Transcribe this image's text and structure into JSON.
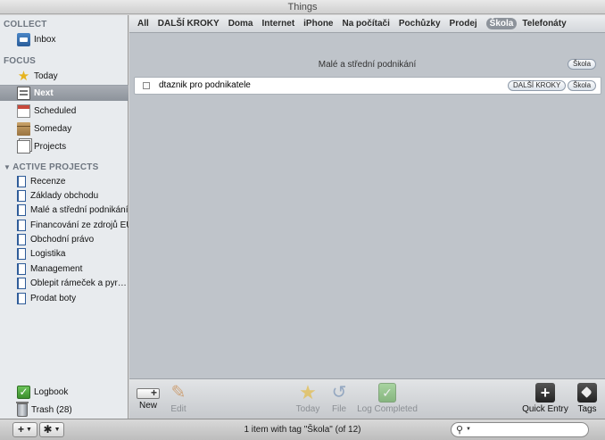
{
  "window": {
    "title": "Things"
  },
  "sidebar": {
    "collect": {
      "label": "COLLECT",
      "items": [
        {
          "label": "Inbox",
          "icon": "inbox-icon"
        }
      ]
    },
    "focus": {
      "label": "FOCUS",
      "items": [
        {
          "label": "Today",
          "icon": "star-icon"
        },
        {
          "label": "Next",
          "icon": "next-list-icon",
          "selected": true
        },
        {
          "label": "Scheduled",
          "icon": "calendar-icon"
        },
        {
          "label": "Someday",
          "icon": "box-icon"
        },
        {
          "label": "Projects",
          "icon": "projects-icon"
        }
      ]
    },
    "active_projects": {
      "label": "ACTIVE PROJECTS",
      "items": [
        {
          "label": "Recenze"
        },
        {
          "label": "Základy obchodu"
        },
        {
          "label": "Malé a střední podnikání"
        },
        {
          "label": "Financování ze zdrojů EU"
        },
        {
          "label": "Obchodní právo"
        },
        {
          "label": "Logistika"
        },
        {
          "label": "Management"
        },
        {
          "label": "Oblepit rámeček a pyr…"
        },
        {
          "label": "Prodat boty"
        }
      ]
    },
    "bottom": [
      {
        "label": "Logbook",
        "icon": "logbook-icon"
      },
      {
        "label": "Trash (28)",
        "icon": "trash-icon"
      }
    ]
  },
  "tags": [
    {
      "label": "All"
    },
    {
      "label": "DALŠÍ KROKY"
    },
    {
      "label": "Doma"
    },
    {
      "label": "Internet"
    },
    {
      "label": "iPhone"
    },
    {
      "label": "Na počítači"
    },
    {
      "label": "Pochůzky"
    },
    {
      "label": "Prodej"
    },
    {
      "label": "Škola",
      "active": true
    },
    {
      "label": "Telefonáty"
    }
  ],
  "main": {
    "group": {
      "title": "Malé a střední podnikání",
      "tag": "Škola"
    },
    "tasks": [
      {
        "title": "dtaznik pro podnikatele",
        "tags": [
          "DALŠÍ KROKY",
          "Škola"
        ],
        "done": false
      }
    ]
  },
  "toolbar": {
    "new": "New",
    "edit": "Edit",
    "today": "Today",
    "file": "File",
    "log_completed": "Log Completed",
    "quick_entry": "Quick Entry",
    "tags": "Tags"
  },
  "statusbar": {
    "text": "1 item with tag \"Škola\" (of 12)",
    "search_placeholder": "",
    "add_button": "+",
    "action_button": "✱"
  },
  "colors": {
    "selection": "#8d939b",
    "content_bg": "#bfc4ca",
    "sidebar_bg": "#e8ebee"
  }
}
